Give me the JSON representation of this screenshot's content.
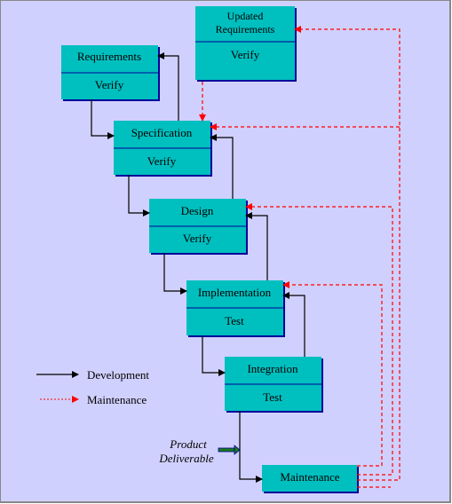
{
  "colors": {
    "background": "#d0d0fe",
    "box": "#00bfbf",
    "box_shadow": "#00009a",
    "development": "#000000",
    "maintenance": "#ff0000",
    "deliverable_arrow": "#1a7a1a"
  },
  "boxes": {
    "updated_requirements": {
      "title_line1": "Updated",
      "title_line2": "Requirements",
      "sub": "Verify"
    },
    "requirements": {
      "title": "Requirements",
      "sub": "Verify"
    },
    "specification": {
      "title": "Specification",
      "sub": "Verify"
    },
    "design": {
      "title": "Design",
      "sub": "Verify"
    },
    "implementation": {
      "title": "Implementation",
      "sub": "Test"
    },
    "integration": {
      "title": "Integration",
      "sub": "Test"
    },
    "maintenance": {
      "title": "Maintenance"
    }
  },
  "legend": {
    "development": "Development",
    "maintenance": "Maintenance"
  },
  "deliverable": {
    "line1": "Product",
    "line2": "Deliverable"
  }
}
